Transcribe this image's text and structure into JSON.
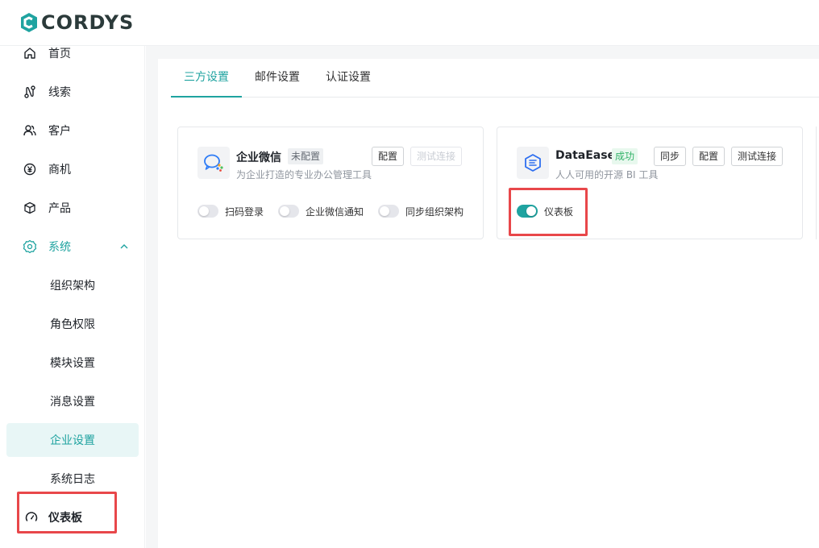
{
  "brand": {
    "name": "CORDYS",
    "accent": "#1fa3a0"
  },
  "sidebar": {
    "items": [
      {
        "label": "首页",
        "icon": "home-icon"
      },
      {
        "label": "线索",
        "icon": "route-icon"
      },
      {
        "label": "客户",
        "icon": "users-icon"
      },
      {
        "label": "商机",
        "icon": "yen-icon"
      },
      {
        "label": "产品",
        "icon": "box-icon"
      },
      {
        "label": "系统",
        "icon": "gear-icon",
        "expanded": true
      }
    ],
    "sub_items": [
      {
        "label": "组织架构"
      },
      {
        "label": "角色权限"
      },
      {
        "label": "模块设置"
      },
      {
        "label": "消息设置"
      },
      {
        "label": "企业设置",
        "selected": true
      },
      {
        "label": "系统日志"
      }
    ],
    "dashboard": {
      "label": "仪表板",
      "icon": "gauge-icon"
    }
  },
  "tabs": [
    {
      "label": "三方设置",
      "active": true
    },
    {
      "label": "邮件设置"
    },
    {
      "label": "认证设置"
    }
  ],
  "cards": [
    {
      "title": "企业微信",
      "status": "未配置",
      "description": "为企业打造的专业办公管理工具",
      "buttons": [
        "配置",
        "测试连接"
      ],
      "toggles": [
        {
          "label": "扫码登录",
          "on": false
        },
        {
          "label": "企业微信通知",
          "on": false
        },
        {
          "label": "同步组织架构",
          "on": false
        }
      ]
    },
    {
      "title": "DataEase",
      "status": "成功",
      "description": "人人可用的开源 BI 工具",
      "buttons": [
        "同步",
        "配置",
        "测试连接"
      ],
      "toggles": [
        {
          "label": "仪表板",
          "on": true
        }
      ]
    }
  ],
  "colors": {
    "highlight": "#e8474a",
    "success": "#34b36a"
  }
}
